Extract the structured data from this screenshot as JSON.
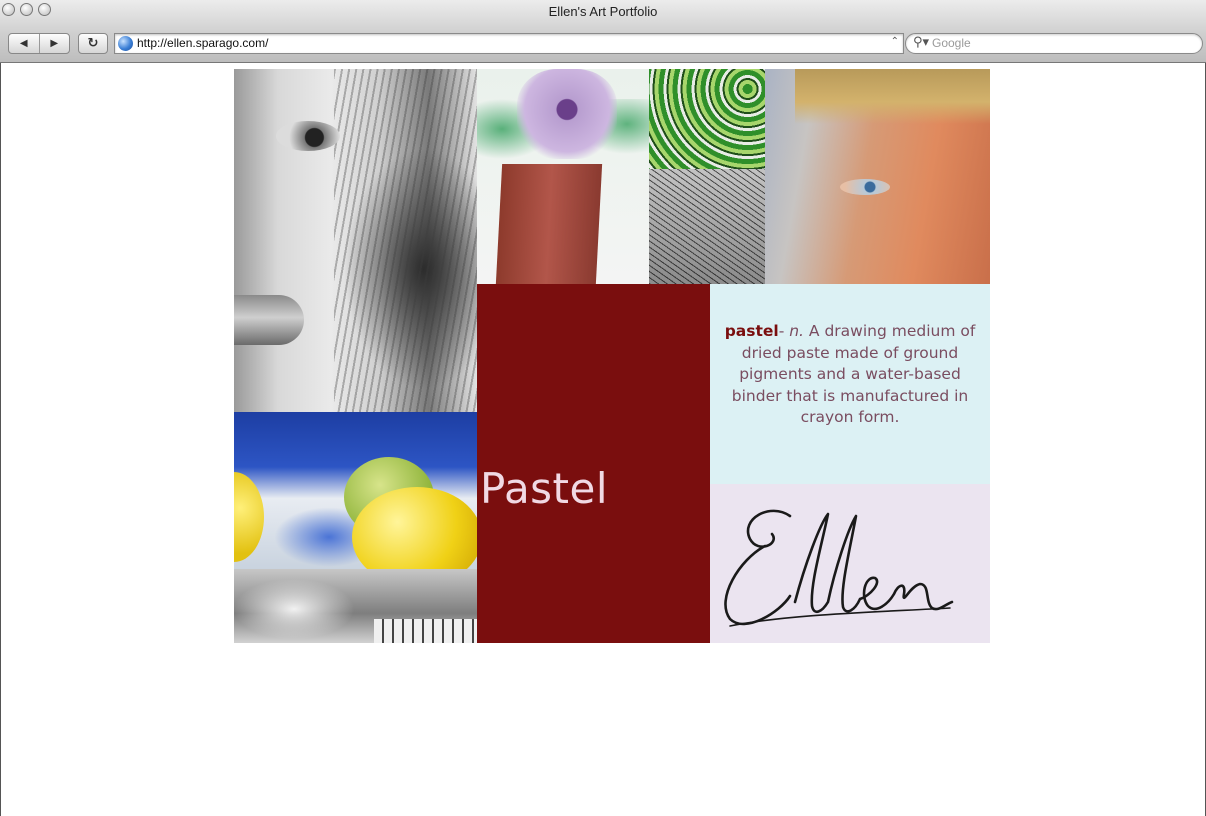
{
  "browser": {
    "window_title": "Ellen's Art Portfolio",
    "url": "http://ellen.sparago.com/",
    "search_placeholder": "Google",
    "back_icon": "back-arrow-icon",
    "forward_icon": "forward-arrow-icon",
    "reload_icon": "reload-icon",
    "search_icon": "magnifier-icon"
  },
  "page": {
    "heading": "Pastel",
    "definition": {
      "term": "pastel",
      "separator": "- ",
      "part_of_speech": "n.",
      "text": " A drawing medium of dried  paste made of ground pigments and a water-based binder that is manufactured in crayon form."
    },
    "signature": "Ellen",
    "colors": {
      "accent_red": "#7a0e0e",
      "definition_bg": "#dcf1f4",
      "signature_bg": "#ebe4f0",
      "heading_text": "#f1d9e4"
    }
  }
}
